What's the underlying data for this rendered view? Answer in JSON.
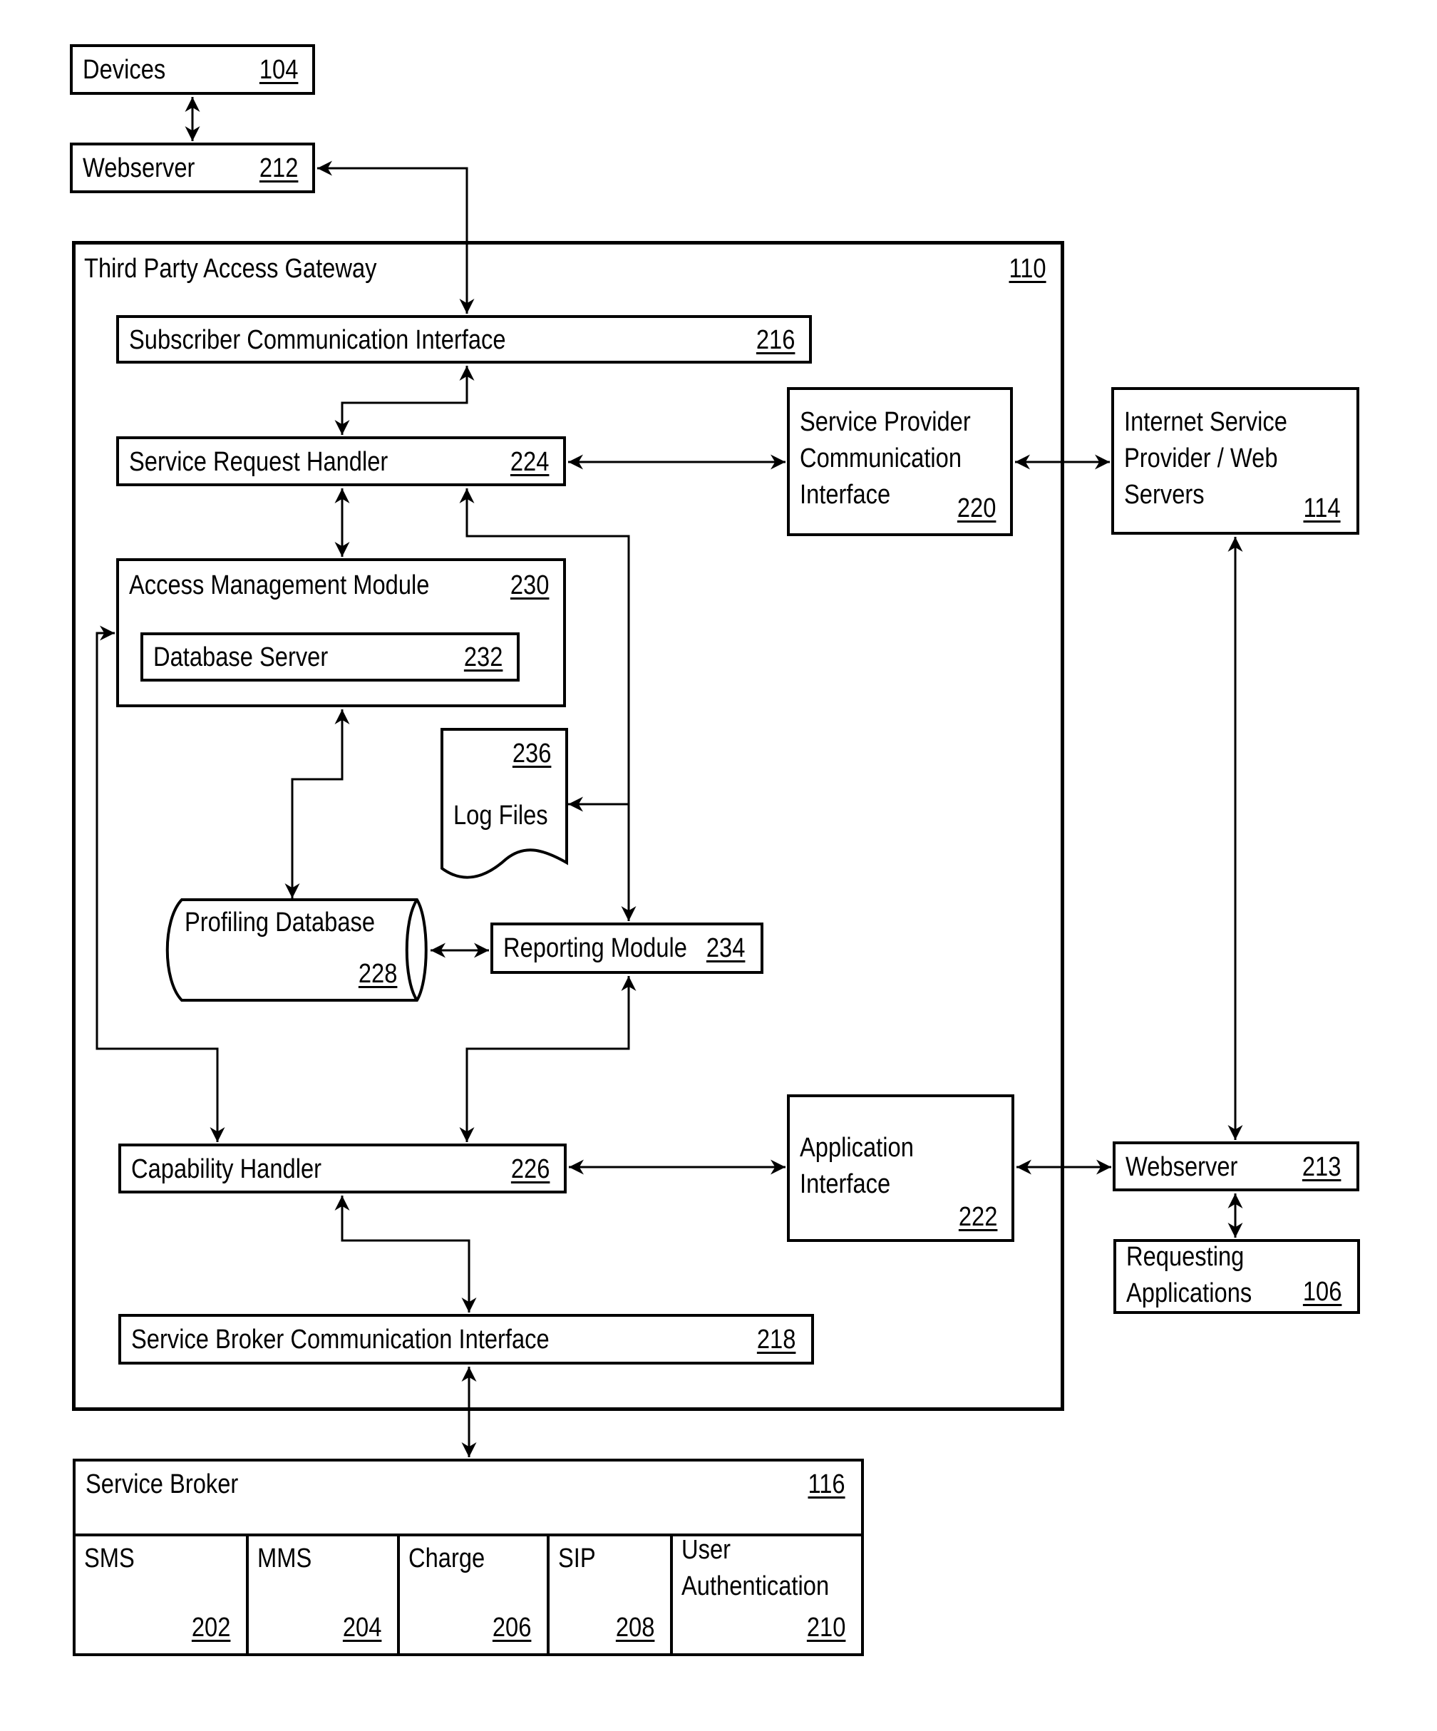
{
  "diagram": {
    "external": {
      "devices": {
        "label": "Devices",
        "ref": "104"
      },
      "webserver_top": {
        "label": "Webserver",
        "ref": "212"
      },
      "isp": {
        "label": "Internet Service\nProvider / Web\nServers",
        "ref": "114"
      },
      "webserver_right": {
        "label": "Webserver",
        "ref": "213"
      },
      "requesting_apps": {
        "label": "Requesting\nApplications",
        "ref": "106"
      }
    },
    "gateway": {
      "label": "Third Party Access Gateway",
      "ref": "110",
      "subscriber_ci": {
        "label": "Subscriber Communication Interface",
        "ref": "216"
      },
      "service_request_handler": {
        "label": "Service Request Handler",
        "ref": "224"
      },
      "service_provider_ci": {
        "label": "Service Provider\nCommunication\nInterface",
        "ref": "220"
      },
      "access_management": {
        "label": "Access Management Module",
        "ref": "230"
      },
      "database_server": {
        "label": "Database Server",
        "ref": "232"
      },
      "log_files": {
        "label": "Log Files",
        "ref": "236"
      },
      "profiling_db": {
        "label": "Profiling Database",
        "ref": "228"
      },
      "reporting_module": {
        "label": "Reporting Module",
        "ref": "234"
      },
      "capability_handler": {
        "label": "Capability Handler",
        "ref": "226"
      },
      "application_interface": {
        "label": "Application\nInterface",
        "ref": "222"
      },
      "service_broker_ci": {
        "label": "Service Broker Communication Interface",
        "ref": "218"
      }
    },
    "service_broker": {
      "label": "Service Broker",
      "ref": "116",
      "components": [
        {
          "label": "SMS",
          "ref": "202"
        },
        {
          "label": "MMS",
          "ref": "204"
        },
        {
          "label": "Charge",
          "ref": "206"
        },
        {
          "label": "SIP",
          "ref": "208"
        },
        {
          "label": "User\nAuthentication",
          "ref": "210"
        }
      ]
    }
  }
}
